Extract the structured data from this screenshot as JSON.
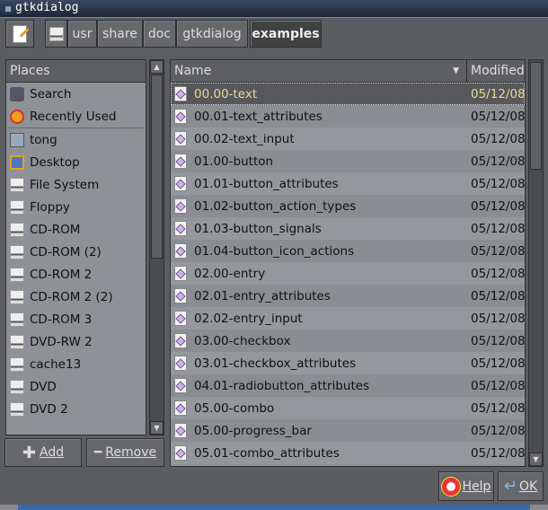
{
  "window": {
    "title": "gtkdialog"
  },
  "toolbar": {
    "edit_icon": "text-editor-icon",
    "crumbs": [
      {
        "label": "",
        "icon": "drive-icon"
      },
      {
        "label": "usr"
      },
      {
        "label": "share"
      },
      {
        "label": "doc"
      },
      {
        "label": "gtkdialog"
      },
      {
        "label": "examples",
        "active": true
      }
    ]
  },
  "places": {
    "header": "Places",
    "items": [
      {
        "label": "Search",
        "icon": "binoculars-icon"
      },
      {
        "label": "Recently Used",
        "icon": "clock-icon"
      },
      {
        "label": "tong",
        "icon": "home-folder-icon"
      },
      {
        "label": "Desktop",
        "icon": "desktop-icon"
      },
      {
        "label": "File System",
        "icon": "harddisk-icon"
      },
      {
        "label": "Floppy",
        "icon": "drive-icon"
      },
      {
        "label": "CD-ROM",
        "icon": "drive-icon"
      },
      {
        "label": "CD-ROM (2)",
        "icon": "drive-icon"
      },
      {
        "label": "CD-ROM 2",
        "icon": "drive-icon"
      },
      {
        "label": "CD-ROM 2 (2)",
        "icon": "drive-icon"
      },
      {
        "label": "CD-ROM 3",
        "icon": "drive-icon"
      },
      {
        "label": "DVD-RW 2",
        "icon": "drive-icon"
      },
      {
        "label": "cache13",
        "icon": "harddisk-icon"
      },
      {
        "label": "DVD",
        "icon": "drive-icon"
      },
      {
        "label": "DVD 2",
        "icon": "drive-icon"
      }
    ],
    "add_label": "Add",
    "remove_label": "Remove"
  },
  "files": {
    "col_name": "Name",
    "col_modified": "Modified",
    "rows": [
      {
        "name": "00.00-text",
        "modified": "05/12/08",
        "selected": true
      },
      {
        "name": "00.01-text_attributes",
        "modified": "05/12/08"
      },
      {
        "name": "00.02-text_input",
        "modified": "05/12/08"
      },
      {
        "name": "01.00-button",
        "modified": "05/12/08"
      },
      {
        "name": "01.01-button_attributes",
        "modified": "05/12/08"
      },
      {
        "name": "01.02-button_action_types",
        "modified": "05/12/08"
      },
      {
        "name": "01.03-button_signals",
        "modified": "05/12/08"
      },
      {
        "name": "01.04-button_icon_actions",
        "modified": "05/12/08"
      },
      {
        "name": "02.00-entry",
        "modified": "05/12/08"
      },
      {
        "name": "02.01-entry_attributes",
        "modified": "05/12/08"
      },
      {
        "name": "02.02-entry_input",
        "modified": "05/12/08"
      },
      {
        "name": "03.00-checkbox",
        "modified": "05/12/08"
      },
      {
        "name": "03.01-checkbox_attributes",
        "modified": "05/12/08"
      },
      {
        "name": "04.01-radiobutton_attributes",
        "modified": "05/12/08"
      },
      {
        "name": "05.00-combo",
        "modified": "05/12/08"
      },
      {
        "name": "05.00-progress_bar",
        "modified": "05/12/08"
      },
      {
        "name": "05.01-combo_attributes",
        "modified": "05/12/08"
      }
    ]
  },
  "buttons": {
    "help": "Help",
    "ok": "OK"
  }
}
